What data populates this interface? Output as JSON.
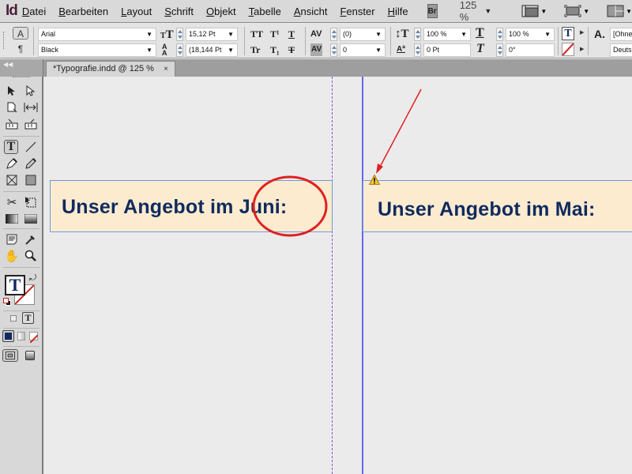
{
  "app": {
    "logo": "Id",
    "menu": [
      {
        "label": "Datei",
        "accel": "D",
        "rest": "atei"
      },
      {
        "label": "Bearbeiten",
        "accel": "B",
        "rest": "earbeiten"
      },
      {
        "label": "Layout",
        "accel": "L",
        "rest": "ayout"
      },
      {
        "label": "Schrift",
        "accel": "S",
        "rest": "chrift"
      },
      {
        "label": "Objekt",
        "accel": "O",
        "rest": "bjekt"
      },
      {
        "label": "Tabelle",
        "accel": "T",
        "rest": "abelle"
      },
      {
        "label": "Ansicht",
        "accel": "A",
        "rest": "nsicht"
      },
      {
        "label": "Fenster",
        "accel": "F",
        "rest": "enster"
      },
      {
        "label": "Hilfe",
        "accel": "H",
        "rest": "ilfe"
      }
    ],
    "bridge_label": "Br",
    "zoom_level": "125 %"
  },
  "control_panel": {
    "character_mode": "A",
    "paragraph_mode": "¶",
    "font_family": "Arial",
    "font_style": "Black",
    "font_size": "15,12 Pt",
    "leading": "(18,144 Pt",
    "kerning": "(0)",
    "tracking": "0",
    "vertical_scale": "100 %",
    "baseline_shift": "0 Pt",
    "horizontal_scale": "100 %",
    "skew": "0°",
    "char_style": "[Ohne",
    "language": "Deuts",
    "buttons": {
      "all_caps": "TT",
      "superscript": "T¹",
      "underline": "T",
      "small_caps": "Tr",
      "subscript": "T₁",
      "strikethrough": "T"
    }
  },
  "document_tab": {
    "title": "*Typografie.indd @ 125 %",
    "close": "×"
  },
  "canvas": {
    "frame_left_text": "Unser Angebot im Juni:",
    "frame_right_text": "Unser Angebot im Mai:",
    "annotation_color": "#e02020",
    "text_color": "#102a5e",
    "frame_fill": "#fdebd0"
  }
}
